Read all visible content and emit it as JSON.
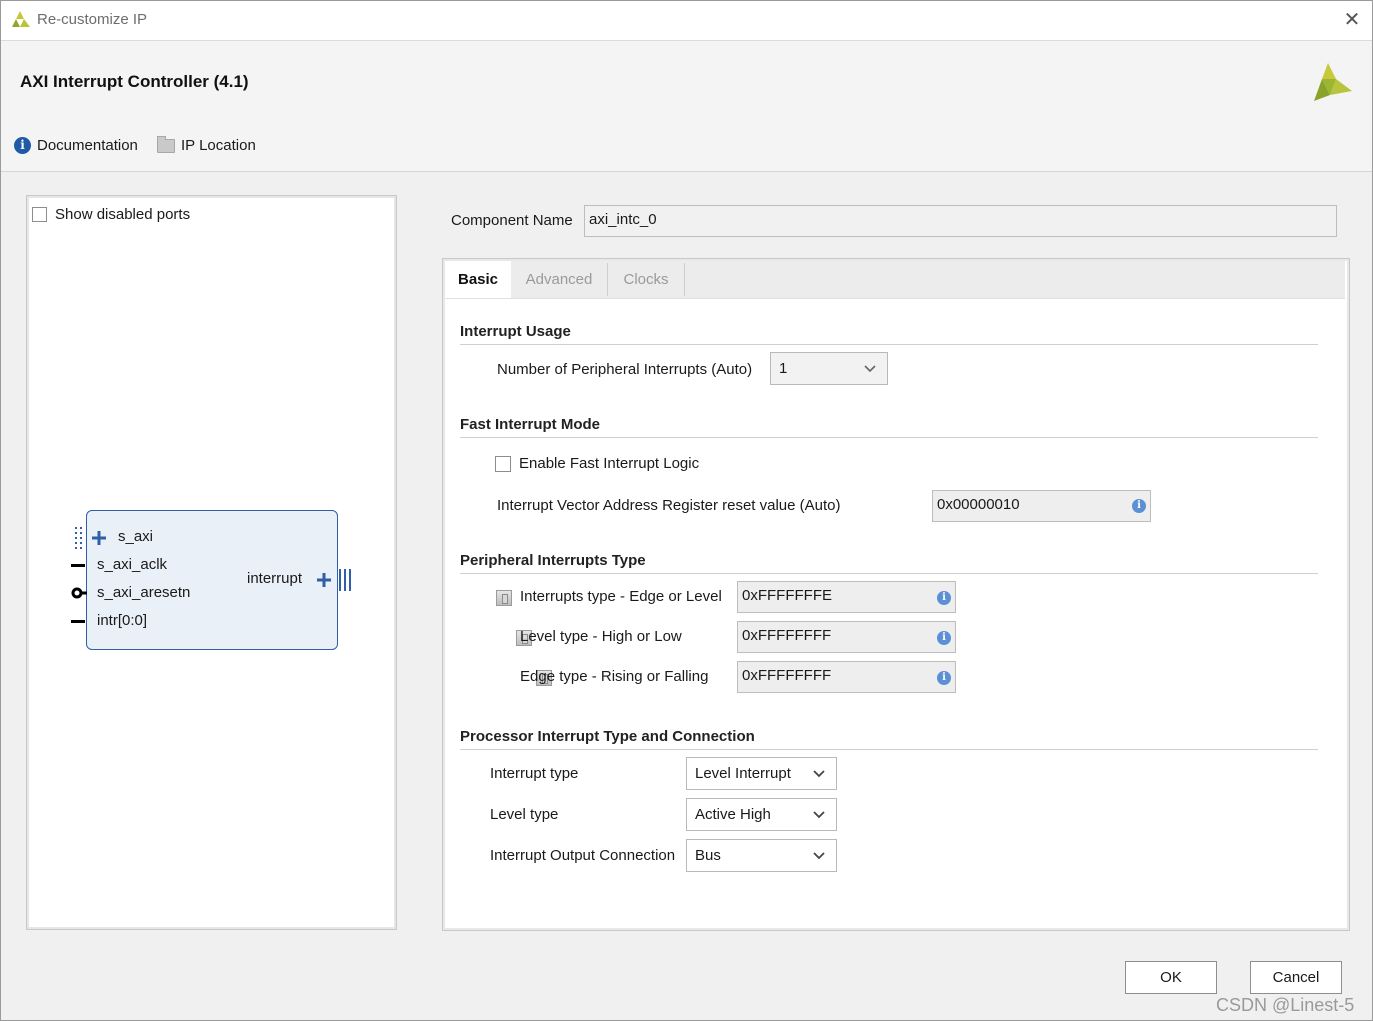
{
  "window": {
    "title": "Re-customize IP",
    "close_icon": "close-icon"
  },
  "header": {
    "ip_title": "AXI Interrupt Controller (4.1)",
    "documentation_label": "Documentation",
    "ip_location_label": "IP Location"
  },
  "left_panel": {
    "show_disabled_ports_label": "Show disabled ports",
    "show_disabled_ports_checked": false,
    "symbol": {
      "ports_left": [
        "s_axi",
        "s_axi_aclk",
        "s_axi_aresetn",
        "intr[0:0]"
      ],
      "port_right": "interrupt"
    }
  },
  "component": {
    "label": "Component Name",
    "value": "axi_intc_0"
  },
  "tabs": [
    {
      "label": "Basic",
      "active": true
    },
    {
      "label": "Advanced",
      "active": false
    },
    {
      "label": "Clocks",
      "active": false
    }
  ],
  "basic": {
    "interrupt_usage": {
      "heading": "Interrupt Usage",
      "num_label": "Number of Peripheral Interrupts (Auto)",
      "num_value": "1"
    },
    "fast_mode": {
      "heading": "Fast Interrupt Mode",
      "enable_label": "Enable Fast Interrupt Logic",
      "enable_checked": false,
      "ivar_label": "Interrupt Vector Address Register reset value (Auto)",
      "ivar_value": "0x00000010"
    },
    "peripheral_type": {
      "heading": "Peripheral Interrupts Type",
      "rows": [
        {
          "label": "Interrupts type - Edge or Level",
          "value": "0xFFFFFFFE"
        },
        {
          "label": "Level type - High or Low",
          "value": "0xFFFFFFFF"
        },
        {
          "label": "Edge type - Rising or Falling",
          "value": "0xFFFFFFFF"
        }
      ]
    },
    "processor": {
      "heading": "Processor Interrupt Type and Connection",
      "interrupt_type_label": "Interrupt type",
      "interrupt_type_value": "Level Interrupt",
      "level_type_label": "Level type",
      "level_type_value": "Active High",
      "output_conn_label": "Interrupt Output Connection",
      "output_conn_value": "Bus"
    }
  },
  "buttons": {
    "ok": "OK",
    "cancel": "Cancel"
  },
  "watermark": "CSDN @Linest-5",
  "colors": {
    "accent_blue": "#2e5fa8",
    "logo_green": "#8fa82a",
    "info_blue": "#5b8fd6"
  }
}
